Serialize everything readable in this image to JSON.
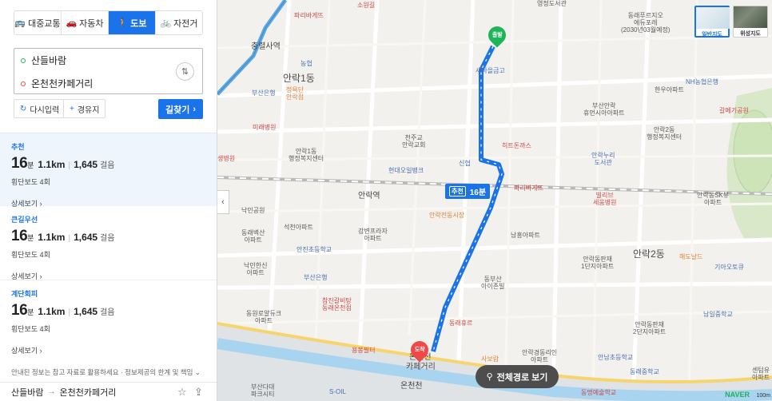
{
  "modes": [
    {
      "label": "대중교통",
      "icon": "bus-icon",
      "active": false
    },
    {
      "label": "자동차",
      "icon": "car-icon",
      "active": false
    },
    {
      "label": "도보",
      "icon": "walk-icon",
      "active": true
    },
    {
      "label": "자전거",
      "icon": "bicycle-icon",
      "active": false
    }
  ],
  "search": {
    "origin": "산들바람",
    "destination": "온천천카페거리"
  },
  "actions": {
    "reset": "다시입력",
    "waypoint": "경유지",
    "go": "길찾기"
  },
  "routes": [
    {
      "tag": "추천",
      "minutes": "16",
      "min_unit": "분",
      "distance": "1.1km",
      "steps": "1,645",
      "steps_unit": "걸음",
      "crosswalk": "횡단보도 4회",
      "more": "상세보기"
    },
    {
      "tag": "큰길우선",
      "minutes": "16",
      "min_unit": "분",
      "distance": "1.1km",
      "steps": "1,645",
      "steps_unit": "걸음",
      "crosswalk": "횡단보도 4회",
      "more": "상세보기"
    },
    {
      "tag": "계단회피",
      "minutes": "16",
      "min_unit": "분",
      "distance": "1.1km",
      "steps": "1,645",
      "steps_unit": "걸음",
      "crosswalk": "횡단보도 4회",
      "more": "상세보기"
    }
  ],
  "notice": "안내된 정보는 참고 자료로 활용하세요 · 정보제공의 한계 및 책임",
  "footer": {
    "origin": "산들바람",
    "destination": "온천천카페거리"
  },
  "map": {
    "route_tag": "추천",
    "route_time": "16분",
    "start_label": "출발",
    "end_label": "도착",
    "full_route_button": "전체경로 보기",
    "map_types": {
      "basic": "일반지도",
      "satellite": "위성지도"
    },
    "brand": "NAVER",
    "scale": "100m",
    "route_color": "#1a73e8",
    "labels": {
      "l1": "파리바게뜨",
      "l2": "소원길",
      "l3": "영정도서관",
      "l4": "동래푸르지오\n에듀포레\n(2030년03월예정)",
      "l5": "충렬사역",
      "l6": "농협",
      "l7": "안락1동",
      "l8": "새마을금고",
      "l9": "부산은행",
      "l10": "정욕단\n안락점",
      "l11": "NH농협은행",
      "l12": "한우아파트",
      "l13": "부산안락\n휴먼시아아파트",
      "l14": "갈메기공원",
      "l15": "미래병원",
      "l16": "천주교\n안락교회",
      "l17": "히트돈까스",
      "l18": "안락2동\n행정복지센터",
      "l19": "안락1동\n행정복지센터",
      "l20": "신협",
      "l21": "안락누리\n도서관",
      "l22": "생병원",
      "l23": "현대오일뱅크",
      "l24": "안락역",
      "l25": "파리바게뜨",
      "l26": "빌리브\n세움병원",
      "l27": "안락동SK뷰\n아파트",
      "l28": "안락전동시장",
      "l29": "낙민공원",
      "l30": "동래벽산\n아파트",
      "l31": "석천아파트",
      "l32": "강변프라자\n아파트",
      "l33": "남흥아파트",
      "l34": "안락동판재\n1단지아파트",
      "l35": "안락2동",
      "l36": "해도날드",
      "l37": "기아오토큐",
      "l38": "안진초등학교",
      "l39": "낙민한신\n아파트",
      "l40": "부산은행",
      "l41": "동부산\n아이존빌",
      "l42": "참진갈비탕\n동래온천점",
      "l43": "동원로얄듀크\n아파트",
      "l44": "동래휴르",
      "l45": "안락동판재\n2단지아파트",
      "l46": "남일중학교",
      "l47": "용봉필터",
      "l48": "온천천",
      "l49": "카페거리",
      "l50": "사보람",
      "l51": "안락경동리인\n아파트",
      "l52": "안남초등학교",
      "l53": "동래중학교",
      "l54": "부산다대\n파크시티",
      "l55": "S-OIL",
      "l56": "온천천",
      "l57": "센텀유\n아파트",
      "l58": "동명예술학교"
    }
  }
}
